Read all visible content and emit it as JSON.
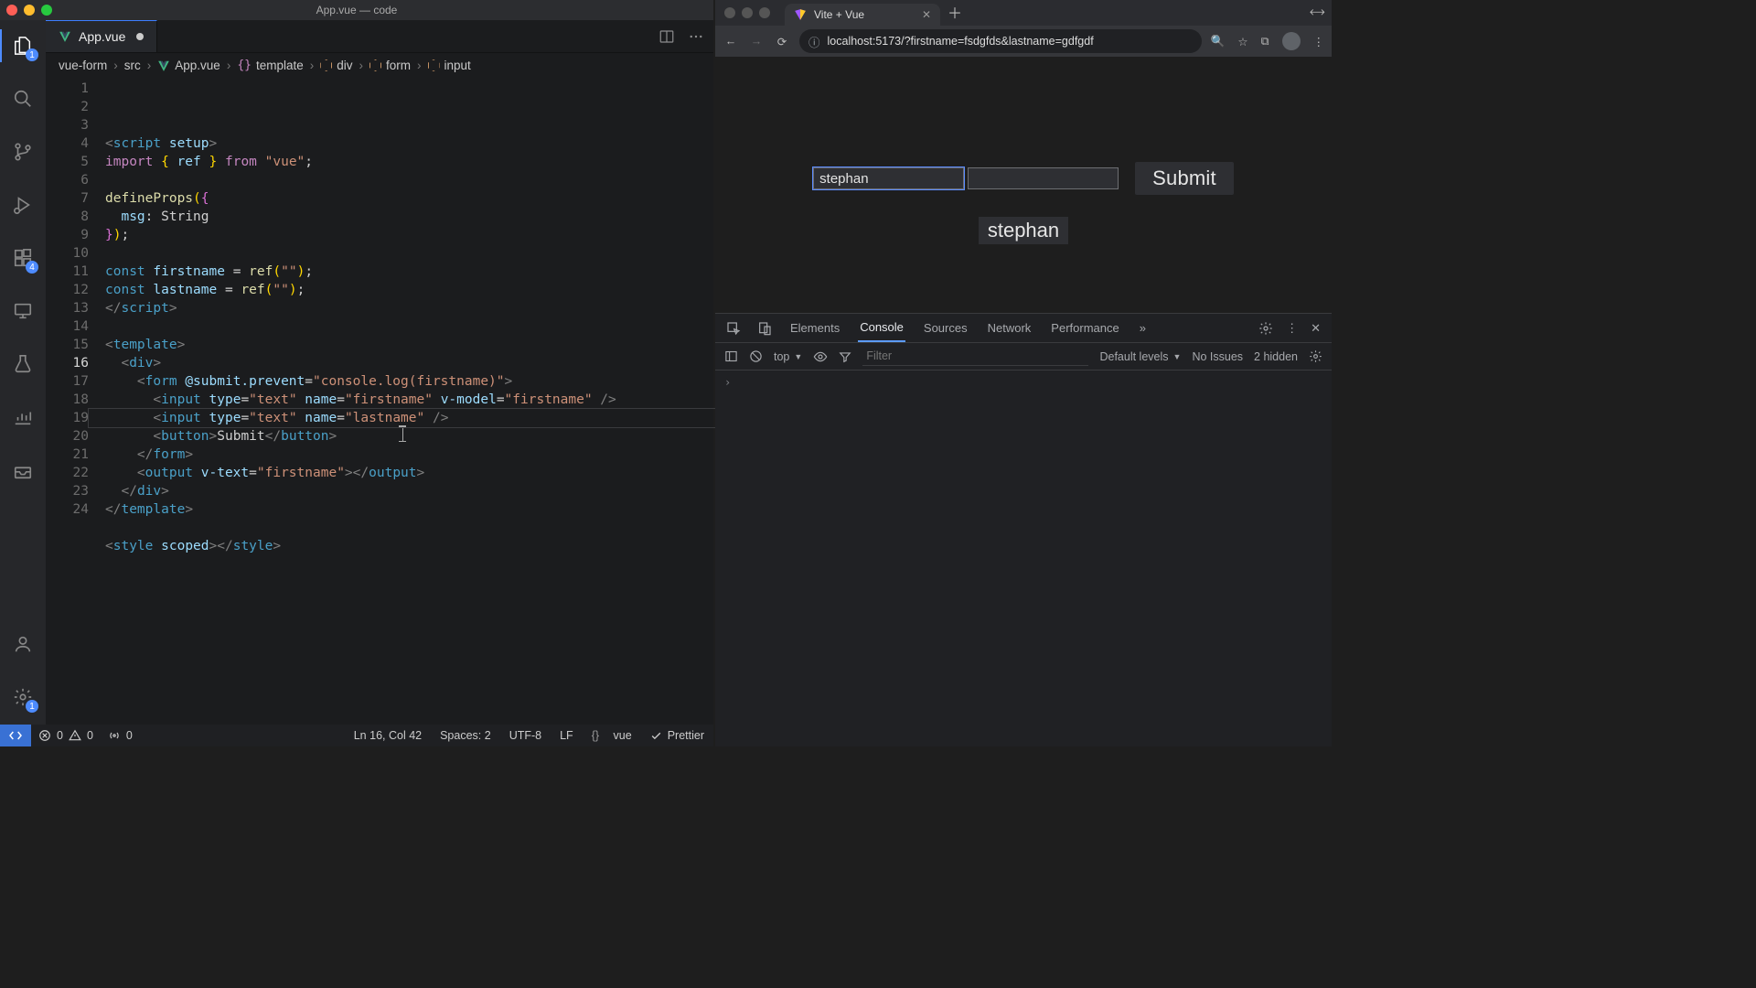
{
  "desktop": {
    "title": "App.vue — code"
  },
  "editor": {
    "tab": {
      "filename": "App.vue",
      "dirty": true
    },
    "breadcrumbs": [
      "vue-form",
      "src",
      "App.vue",
      "template",
      "div",
      "form",
      "input"
    ],
    "bc_brackets": "{}",
    "activity_badges": {
      "explorer": "1",
      "extensions": "4",
      "settings": "1"
    },
    "status": {
      "errors": "0",
      "warnings": "0",
      "ports": "0",
      "cursor": "Ln 16, Col 42",
      "indent": "Spaces: 2",
      "encoding": "UTF-8",
      "eol": "LF",
      "lang": "vue",
      "formatter": "Prettier"
    },
    "active_line": "16",
    "line_count": 24,
    "code_lines": [
      [
        [
          "punc",
          "<"
        ],
        [
          "tag",
          "script "
        ],
        [
          "attr",
          "setup"
        ],
        [
          "punc",
          ">"
        ]
      ],
      [
        [
          "kw2",
          "import "
        ],
        [
          "br",
          "{ "
        ],
        [
          "var",
          "ref"
        ],
        [
          "br",
          " } "
        ],
        [
          "kw2",
          "from "
        ],
        [
          "str",
          "\"vue\""
        ],
        [
          "plain",
          ";"
        ]
      ],
      [
        [
          "plain",
          ""
        ]
      ],
      [
        [
          "fn",
          "defineProps"
        ],
        [
          "br",
          "("
        ],
        [
          "br2",
          "{"
        ]
      ],
      [
        [
          "plain",
          "  "
        ],
        [
          "attr",
          "msg"
        ],
        [
          "plain",
          ": String"
        ]
      ],
      [
        [
          "br2",
          "}"
        ],
        [
          "br",
          ")"
        ],
        [
          "plain",
          ";"
        ]
      ],
      [
        [
          "plain",
          ""
        ]
      ],
      [
        [
          "tag",
          "const "
        ],
        [
          "var",
          "firstname"
        ],
        [
          "plain",
          " = "
        ],
        [
          "fn",
          "ref"
        ],
        [
          "br",
          "("
        ],
        [
          "str",
          "\"\""
        ],
        [
          "br",
          ")"
        ],
        [
          "plain",
          ";"
        ]
      ],
      [
        [
          "tag",
          "const "
        ],
        [
          "var",
          "lastname"
        ],
        [
          "plain",
          " = "
        ],
        [
          "fn",
          "ref"
        ],
        [
          "br",
          "("
        ],
        [
          "str",
          "\"\""
        ],
        [
          "br",
          ")"
        ],
        [
          "plain",
          ";"
        ]
      ],
      [
        [
          "punc",
          "</"
        ],
        [
          "tag",
          "script"
        ],
        [
          "punc",
          ">"
        ]
      ],
      [
        [
          "plain",
          ""
        ]
      ],
      [
        [
          "punc",
          "<"
        ],
        [
          "tag",
          "template"
        ],
        [
          "punc",
          ">"
        ]
      ],
      [
        [
          "plain",
          "  "
        ],
        [
          "punc",
          "<"
        ],
        [
          "tag",
          "div"
        ],
        [
          "punc",
          ">"
        ]
      ],
      [
        [
          "plain",
          "    "
        ],
        [
          "punc",
          "<"
        ],
        [
          "tag",
          "form "
        ],
        [
          "attr",
          "@submit.prevent"
        ],
        [
          "plain",
          "="
        ],
        [
          "str",
          "\"console.log(firstname)\""
        ],
        [
          "punc",
          ">"
        ]
      ],
      [
        [
          "plain",
          "      "
        ],
        [
          "punc",
          "<"
        ],
        [
          "tag",
          "input "
        ],
        [
          "attr",
          "type"
        ],
        [
          "plain",
          "="
        ],
        [
          "str",
          "\"text\" "
        ],
        [
          "attr",
          "name"
        ],
        [
          "plain",
          "="
        ],
        [
          "str",
          "\"firstname\" "
        ],
        [
          "attr",
          "v-model"
        ],
        [
          "plain",
          "="
        ],
        [
          "str",
          "\"firstname\""
        ],
        [
          "punc",
          " />"
        ]
      ],
      [
        [
          "plain",
          "      "
        ],
        [
          "punc",
          "<"
        ],
        [
          "tag",
          "input "
        ],
        [
          "attr",
          "type"
        ],
        [
          "plain",
          "="
        ],
        [
          "str",
          "\"text\" "
        ],
        [
          "attr",
          "name"
        ],
        [
          "plain",
          "="
        ],
        [
          "str",
          "\"lastname\""
        ],
        [
          "punc",
          " />"
        ]
      ],
      [
        [
          "plain",
          "      "
        ],
        [
          "punc",
          "<"
        ],
        [
          "tag",
          "button"
        ],
        [
          "punc",
          ">"
        ],
        [
          "plain",
          "Submit"
        ],
        [
          "punc",
          "</"
        ],
        [
          "tag",
          "button"
        ],
        [
          "punc",
          ">"
        ]
      ],
      [
        [
          "plain",
          "    "
        ],
        [
          "punc",
          "</"
        ],
        [
          "tag",
          "form"
        ],
        [
          "punc",
          ">"
        ]
      ],
      [
        [
          "plain",
          "    "
        ],
        [
          "punc",
          "<"
        ],
        [
          "tag",
          "output "
        ],
        [
          "attr",
          "v-text"
        ],
        [
          "plain",
          "="
        ],
        [
          "str",
          "\"firstname\""
        ],
        [
          "punc",
          "></"
        ],
        [
          "tag",
          "output"
        ],
        [
          "punc",
          ">"
        ]
      ],
      [
        [
          "plain",
          "  "
        ],
        [
          "punc",
          "</"
        ],
        [
          "tag",
          "div"
        ],
        [
          "punc",
          ">"
        ]
      ],
      [
        [
          "punc",
          "</"
        ],
        [
          "tag",
          "template"
        ],
        [
          "punc",
          ">"
        ]
      ],
      [
        [
          "plain",
          ""
        ]
      ],
      [
        [
          "punc",
          "<"
        ],
        [
          "tag",
          "style "
        ],
        [
          "attr",
          "scoped"
        ],
        [
          "punc",
          "></"
        ],
        [
          "tag",
          "style"
        ],
        [
          "punc",
          ">"
        ]
      ],
      [
        [
          "plain",
          ""
        ]
      ]
    ]
  },
  "browser": {
    "tab_title": "Vite + Vue",
    "url": "localhost:5173/?firstname=fsdgfds&lastname=gdfgdf",
    "page": {
      "firstname_value": "stephan",
      "lastname_value": "",
      "submit_label": "Submit",
      "output_text": "stephan"
    }
  },
  "devtools": {
    "tabs": [
      "Elements",
      "Console",
      "Sources",
      "Network",
      "Performance"
    ],
    "active_tab": "Console",
    "more": "»",
    "scope": "top",
    "filter_placeholder": "Filter",
    "levels": "Default levels",
    "issues": "No Issues",
    "hidden": "2 hidden"
  }
}
